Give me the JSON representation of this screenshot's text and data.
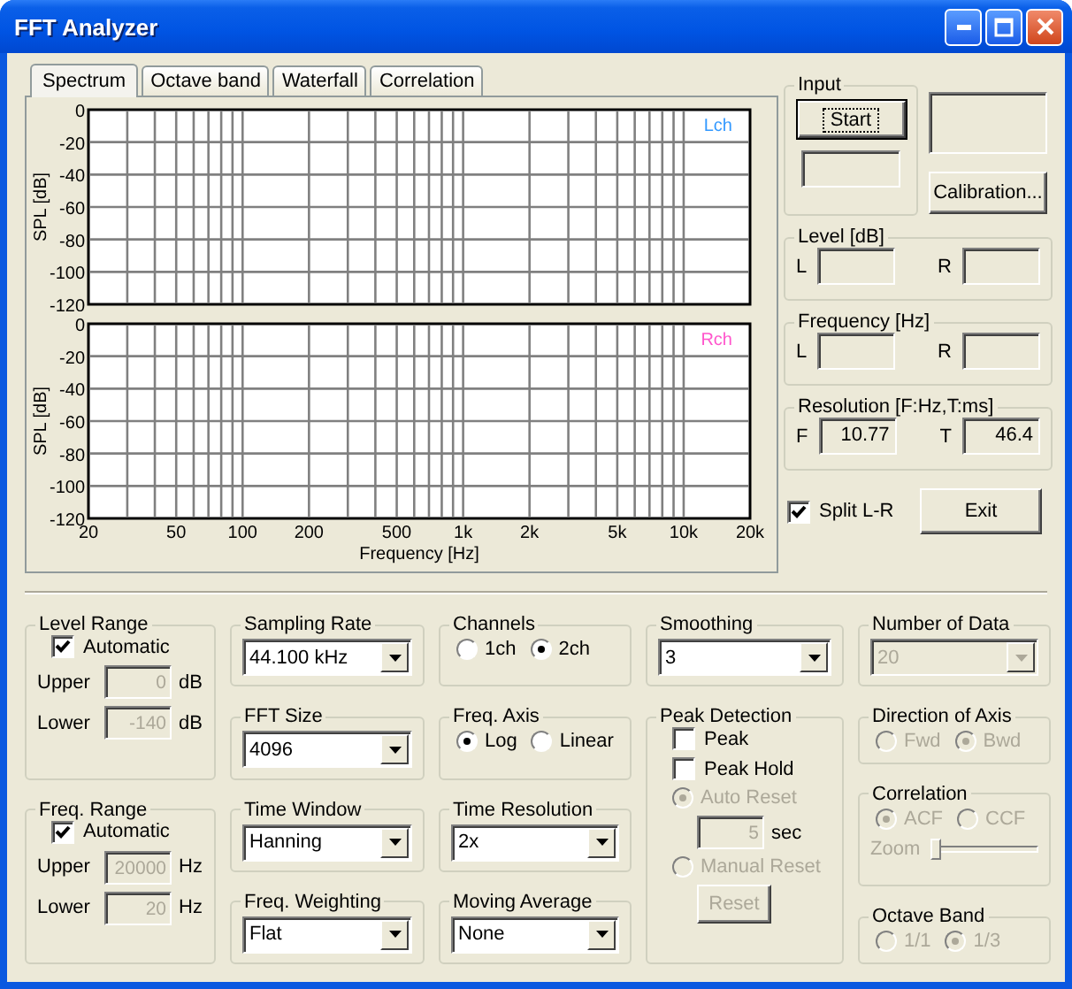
{
  "window": {
    "title": "FFT Analyzer"
  },
  "tabs": [
    {
      "label": "Spectrum",
      "selected": true
    },
    {
      "label": "Octave band",
      "selected": false
    },
    {
      "label": "Waterfall",
      "selected": false
    },
    {
      "label": "Correlation",
      "selected": false
    }
  ],
  "charts": [
    {
      "channel_label": "Lch",
      "color": "#3399ff",
      "ylabel": "SPL [dB]",
      "y_labels": [
        "0",
        "-20",
        "-40",
        "-60",
        "-80",
        "-100",
        "-120"
      ]
    },
    {
      "channel_label": "Rch",
      "color": "#ff55cc",
      "ylabel": "SPL [dB]",
      "y_labels": [
        "0",
        "-20",
        "-40",
        "-60",
        "-80",
        "-100",
        "-120"
      ],
      "xlabel": "Frequency [Hz]",
      "x_labels": [
        "20",
        "50",
        "100",
        "200",
        "500",
        "1k",
        "2k",
        "5k",
        "10k",
        "20k"
      ]
    }
  ],
  "input": {
    "title": "Input",
    "start_button": "Start",
    "calibration_button": "Calibration..."
  },
  "readouts": [
    {
      "title": "Level [dB]",
      "fields": [
        {
          "label": "L"
        },
        {
          "label": "R"
        }
      ]
    },
    {
      "title": "Frequency [Hz]",
      "fields": [
        {
          "label": "L"
        },
        {
          "label": "R"
        }
      ]
    },
    {
      "title": "Resolution [F:Hz,T:ms]",
      "fields": [
        {
          "label": "F",
          "value": "10.77"
        },
        {
          "label": "T",
          "value": "46.4"
        }
      ]
    }
  ],
  "split_lr": {
    "label": "Split L-R",
    "checked": true
  },
  "exit_button": "Exit",
  "settings_columns": [
    {
      "groups": [
        {
          "title": "Level Range",
          "items": [
            {
              "kind": "checkbox",
              "label": "Automatic",
              "checked": true,
              "disabled": false
            },
            {
              "kind": "field",
              "label": "Upper",
              "value": "0",
              "unit": "dB",
              "disabled": true
            },
            {
              "kind": "field",
              "label": "Lower",
              "value": "-140",
              "unit": "dB",
              "disabled": true
            }
          ]
        },
        {
          "title": "Freq. Range",
          "items": [
            {
              "kind": "checkbox",
              "label": "Automatic",
              "checked": true,
              "disabled": false
            },
            {
              "kind": "field",
              "label": "Upper",
              "value": "20000",
              "unit": "Hz",
              "disabled": true
            },
            {
              "kind": "field",
              "label": "Lower",
              "value": "20",
              "unit": "Hz",
              "disabled": true
            }
          ]
        }
      ]
    },
    {
      "groups": [
        {
          "title": "Sampling Rate",
          "items": [
            {
              "kind": "dropdown",
              "value": "44.100 kHz",
              "disabled": false
            }
          ]
        },
        {
          "title": "FFT Size",
          "items": [
            {
              "kind": "dropdown",
              "value": "4096",
              "disabled": false
            }
          ]
        },
        {
          "title": "Time Window",
          "items": [
            {
              "kind": "dropdown",
              "value": "Hanning",
              "disabled": false
            }
          ]
        },
        {
          "title": "Freq. Weighting",
          "items": [
            {
              "kind": "dropdown",
              "value": "Flat",
              "disabled": false
            }
          ]
        }
      ]
    },
    {
      "groups": [
        {
          "title": "Channels",
          "items": [
            {
              "kind": "radios",
              "disabled": false,
              "options": [
                {
                  "label": "1ch",
                  "selected": false
                },
                {
                  "label": "2ch",
                  "selected": true
                }
              ]
            }
          ]
        },
        {
          "title": "Freq. Axis",
          "items": [
            {
              "kind": "radios",
              "disabled": false,
              "options": [
                {
                  "label": "Log",
                  "selected": true
                },
                {
                  "label": "Linear",
                  "selected": false
                }
              ]
            }
          ]
        },
        {
          "title": "Time Resolution",
          "items": [
            {
              "kind": "dropdown",
              "value": "2x",
              "disabled": false
            }
          ]
        },
        {
          "title": "Moving Average",
          "items": [
            {
              "kind": "dropdown",
              "value": "None",
              "disabled": false
            }
          ]
        }
      ]
    },
    {
      "groups": [
        {
          "title": "Smoothing",
          "items": [
            {
              "kind": "dropdown",
              "value": "3",
              "disabled": false
            }
          ]
        },
        {
          "title": "Peak Detection",
          "items": [
            {
              "kind": "checkbox",
              "label": "Peak",
              "checked": false,
              "disabled": false
            },
            {
              "kind": "checkbox",
              "label": "Peak Hold",
              "checked": false,
              "disabled": false
            },
            {
              "kind": "radio",
              "label": "Auto Reset",
              "selected": true,
              "disabled": true
            },
            {
              "kind": "field",
              "value": "5",
              "unit": "sec",
              "disabled": true
            },
            {
              "kind": "radio",
              "label": "Manual Reset",
              "selected": false,
              "disabled": true
            },
            {
              "kind": "button",
              "label": "Reset",
              "disabled": true
            }
          ]
        }
      ]
    },
    {
      "groups": [
        {
          "title": "Number of Data",
          "items": [
            {
              "kind": "dropdown",
              "value": "20",
              "disabled": true
            }
          ]
        },
        {
          "title": "Direction of Axis",
          "items": [
            {
              "kind": "radios",
              "disabled": true,
              "options": [
                {
                  "label": "Fwd",
                  "selected": false
                },
                {
                  "label": "Bwd",
                  "selected": true
                }
              ]
            }
          ]
        },
        {
          "title": "Correlation",
          "items": [
            {
              "kind": "radios",
              "disabled": true,
              "options": [
                {
                  "label": "ACF",
                  "selected": true
                },
                {
                  "label": "CCF",
                  "selected": false
                }
              ]
            },
            {
              "kind": "slider",
              "label": "Zoom",
              "level": 0,
              "disabled": true
            }
          ]
        },
        {
          "title": "Octave Band",
          "items": [
            {
              "kind": "radios",
              "disabled": true,
              "options": [
                {
                  "label": "1/1",
                  "selected": false
                },
                {
                  "label": "1/3",
                  "selected": true
                }
              ]
            }
          ]
        }
      ]
    }
  ]
}
